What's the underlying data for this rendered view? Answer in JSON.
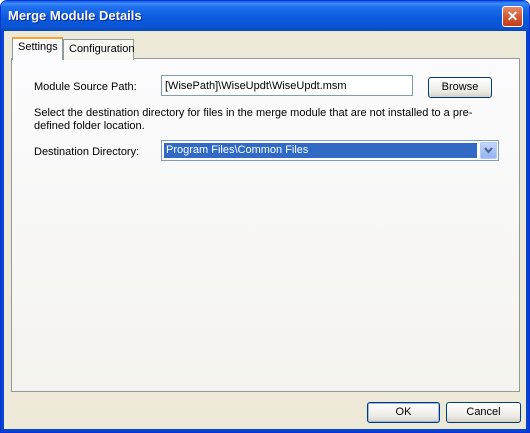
{
  "window": {
    "title": "Merge Module Details",
    "close_label": "✕"
  },
  "tabs": [
    {
      "label": "Settings",
      "active": true
    },
    {
      "label": "Configuration",
      "active": false
    }
  ],
  "settings": {
    "source_label": "Module Source Path:",
    "source_value": "[WisePath]\\WiseUpdt\\WiseUpdt.msm",
    "browse_label": "Browse",
    "description": "Select the destination directory for files in the merge module that are not installed to a pre-defined folder location.",
    "destination_label": "Destination Directory:",
    "destination_value": "Program Files\\Common Files"
  },
  "footer": {
    "ok_label": "OK",
    "cancel_label": "Cancel"
  },
  "colors": {
    "titlebar": "#0a54d4",
    "selection": "#316ac5",
    "dialog_bg": "#ece9d8"
  },
  "icons": {
    "close": "close-icon",
    "dropdown": "chevron-down-icon"
  }
}
